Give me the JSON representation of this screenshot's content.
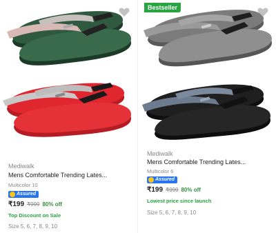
{
  "products": [
    {
      "badge": "",
      "brand": "",
      "title": "",
      "variant": "",
      "colors": {
        "strap": "#d9b9b6",
        "sole": "#2f5a3f",
        "base": "#1d3a28"
      }
    },
    {
      "badge": "Bestseller",
      "brand": "",
      "title": "",
      "variant": "",
      "colors": {
        "strap": "#8a8a8a",
        "sole": "#8f8f8f",
        "base": "#555555"
      }
    },
    {
      "badge": "",
      "brand": "Mediwalk",
      "title": "Mens Comfortable Trending Lates...",
      "variant": "Multicolor 10",
      "assured": "Assured",
      "price": "₹199",
      "mrp": "₹999",
      "discount": "80% off",
      "promo": "Top Discount on Sale",
      "sizes": "Size 5, 6, 7, 8, 9, 10",
      "colors": {
        "strap": "#c8c8c8",
        "sole": "#e0262f",
        "base": "#b51c24"
      }
    },
    {
      "badge": "",
      "brand": "Mediwalk",
      "title": "Mens Comfortable Trending Lates...",
      "variant": "Multicolor 6",
      "assured": "Assured",
      "price": "₹199",
      "mrp": "₹999",
      "discount": "80% off",
      "promo": "Lowest price since launch",
      "sizes": "Size 5, 6, 7, 8, 9, 10",
      "colors": {
        "strap": "#6d7b8f",
        "sole": "#1a1a1a",
        "base": "#0e0e0e"
      }
    }
  ],
  "icons": {
    "wishlist": "heart-icon",
    "assured": "assured-icon"
  }
}
